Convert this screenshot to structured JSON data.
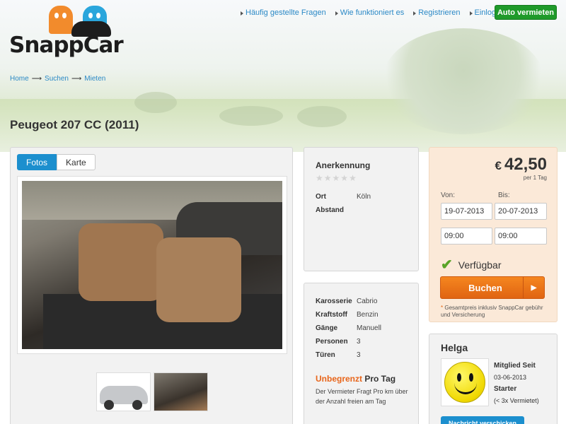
{
  "brand": {
    "name": "SnappCar"
  },
  "topnav": {
    "links": [
      "Häufig gestellte Fragen",
      "Wie funktioniert es",
      "Registrieren",
      "Einloggen"
    ],
    "cta": "Auto vermieten"
  },
  "breadcrumb": [
    "Home",
    "Suchen",
    "Mieten"
  ],
  "page_title": "Peugeot 207 CC (2011)",
  "gallery": {
    "tabs": [
      "Fotos",
      "Karte"
    ],
    "active_tab": "Fotos"
  },
  "recognition": {
    "heading": "Anerkennung",
    "rating": 0,
    "rating_max": 5,
    "rows": [
      {
        "k": "Ort",
        "v": "Köln"
      },
      {
        "k": "Abstand",
        "v": ""
      }
    ]
  },
  "specs": {
    "rows": [
      {
        "k": "Karosserie",
        "v": "Cabrio"
      },
      {
        "k": "Kraftstoff",
        "v": "Benzin"
      },
      {
        "k": "Gänge",
        "v": "Manuell"
      },
      {
        "k": "Personen",
        "v": "3"
      },
      {
        "k": "Türen",
        "v": "3"
      }
    ],
    "unlimited_prefix": "Unbegrenzt",
    "unlimited_suffix": "Pro Tag",
    "unlimited_note": "Der Vermieter Fragt Pro km über der Anzahl freien am Tag"
  },
  "booking": {
    "currency": "€",
    "price": "42,50",
    "per": "per 1 Tag",
    "from_label": "Von:",
    "to_label": "Bis:",
    "from_date": "19-07-2013",
    "to_date": "20-07-2013",
    "from_time": "09:00",
    "to_time": "09:00",
    "availability": "Verfügbar",
    "book_button": "Buchen",
    "note_mark": "*",
    "note": "Gesamtpreis inklusiv SnappCar gebühr und Versicherung",
    "colors": {
      "button": "#e06412",
      "panel": "#fbe9d8",
      "check": "#5aa428"
    }
  },
  "owner": {
    "name": "Helga",
    "member_since_label": "Mitglied Seit",
    "member_since": "03-06-2013",
    "level": "Starter",
    "rentals": "(< 3x Vermietet)",
    "message_button": "Nachricht verschicken"
  },
  "icons": [
    "arrow-right-icon",
    "star-icon",
    "check-icon",
    "play-arrow-icon",
    "smiley-avatar-icon"
  ]
}
